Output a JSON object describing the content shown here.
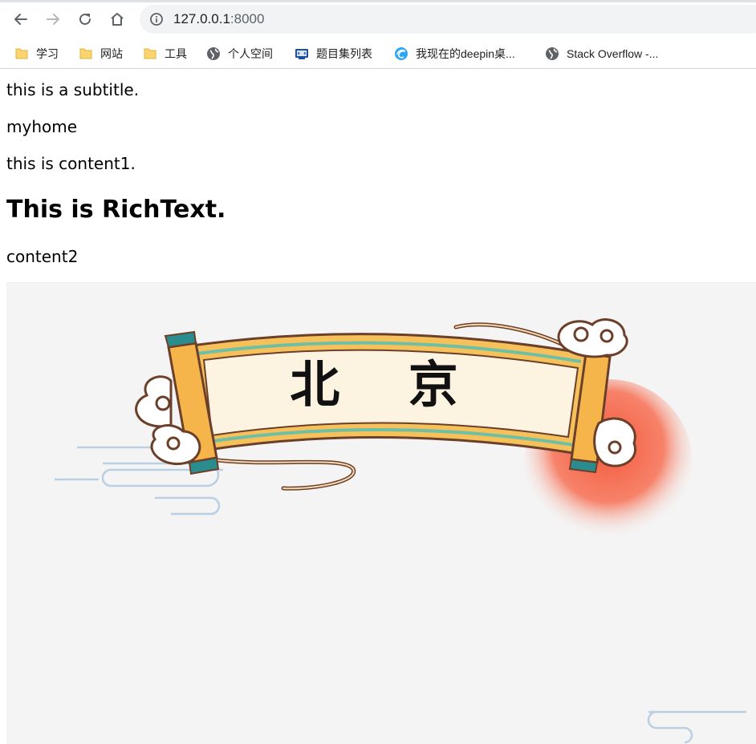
{
  "browser": {
    "url_host": "127.0.0.1",
    "url_port": ":8000",
    "bookmarks": [
      {
        "label": "学习",
        "icon": "folder-icon"
      },
      {
        "label": "网站",
        "icon": "folder-icon"
      },
      {
        "label": "工具",
        "icon": "folder-icon"
      },
      {
        "label": "个人空间",
        "icon": "globe-icon"
      },
      {
        "label": "题目集列表",
        "icon": "site-icon"
      },
      {
        "label": "我现在的deepin桌...",
        "icon": "deepin-icon"
      },
      {
        "label": "Stack Overflow -...",
        "icon": "globe-icon"
      }
    ]
  },
  "page": {
    "subtitle": "this is a subtitle.",
    "home": "myhome",
    "content1": "this is content1.",
    "richtext_heading": "This is RichText.",
    "content2": "content2"
  },
  "banner": {
    "scroll_text": "北 京",
    "colors": {
      "background": "#f4f4f4",
      "scroll_gold": "#f6c15a",
      "scroll_teal": "#6fbfa5",
      "paper": "#fdf3e1",
      "outline": "#6b3f2a",
      "sun": "#f4694a",
      "cloud_line": "#b9cfe3"
    }
  }
}
